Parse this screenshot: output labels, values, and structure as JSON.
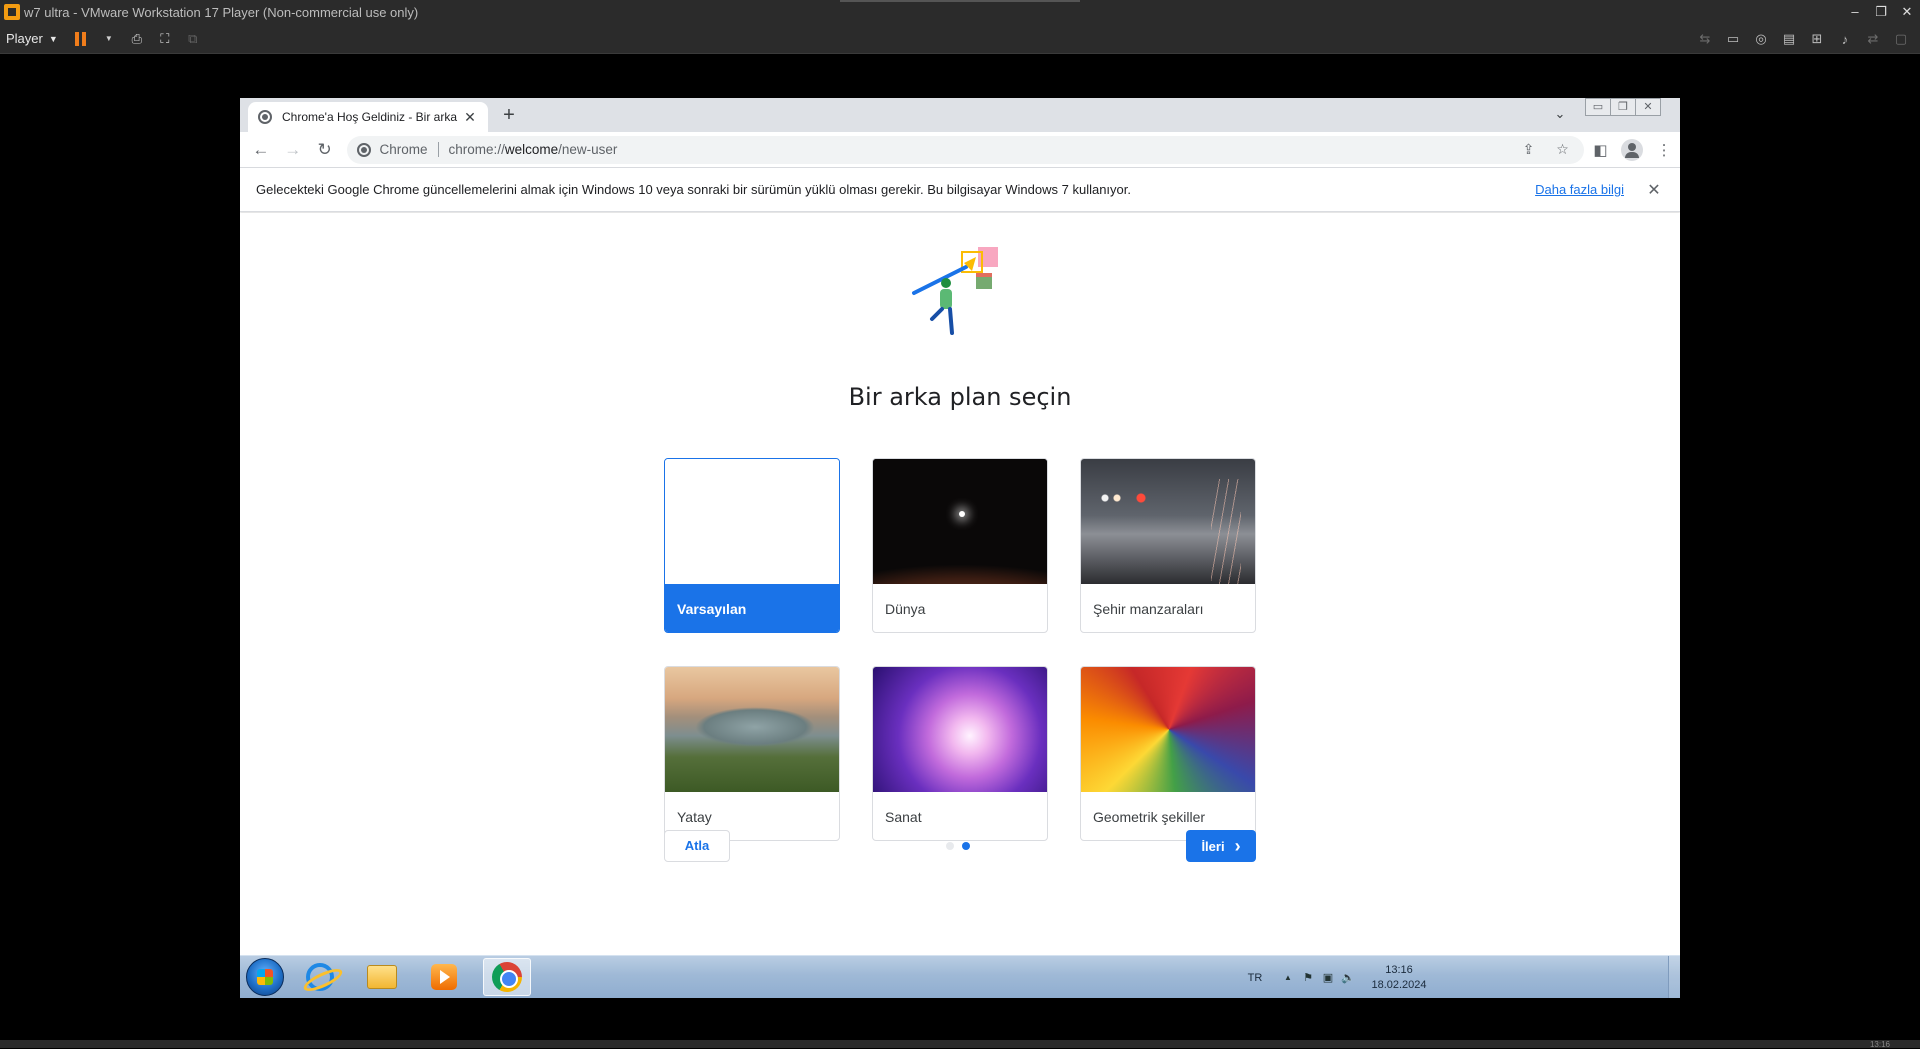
{
  "vmware": {
    "title": "w7 ultra - VMware Workstation 17 Player (Non-commercial use only)",
    "menu_label": "Player",
    "win_minimize": "–",
    "win_restore": "❐",
    "win_close": "✕",
    "bottom_clock": "13:16"
  },
  "browser": {
    "tab": {
      "title": "Chrome'a Hoş Geldiniz - Bir arka",
      "close_glyph": "✕"
    },
    "new_tab_glyph": "+",
    "tab_search_glyph": "⌄",
    "guest_win_buttons": [
      "▭",
      "❐",
      "✕"
    ],
    "omnibox": {
      "chip": "Chrome",
      "url_host": "chrome://",
      "url_bold": "welcome",
      "url_path": "/new-user"
    },
    "infobar": {
      "message": "Gelecekteki Google Chrome güncellemelerini almak için Windows 10 veya sonraki bir sürümün yüklü olması gerekir. Bu bilgisayar Windows 7 kullanıyor.",
      "link": "Daha fazla bilgi",
      "close_glyph": "✕"
    }
  },
  "welcome": {
    "title": "Bir arka plan seçin",
    "backgrounds": [
      {
        "label": "Varsayılan",
        "selected": true
      },
      {
        "label": "Dünya",
        "selected": false
      },
      {
        "label": "Şehir manzaraları",
        "selected": false
      },
      {
        "label": "Yatay",
        "selected": false
      },
      {
        "label": "Sanat",
        "selected": false
      },
      {
        "label": "Geometrik şekiller",
        "selected": false
      }
    ],
    "skip_label": "Atla",
    "next_label": "İleri",
    "next_glyph": "›",
    "step_current": 2,
    "step_total": 2,
    "accent_color": "#1a73e8"
  },
  "taskbar": {
    "language": "TR",
    "tray_arrow": "▲",
    "time": "13:16",
    "date": "18.02.2024"
  }
}
